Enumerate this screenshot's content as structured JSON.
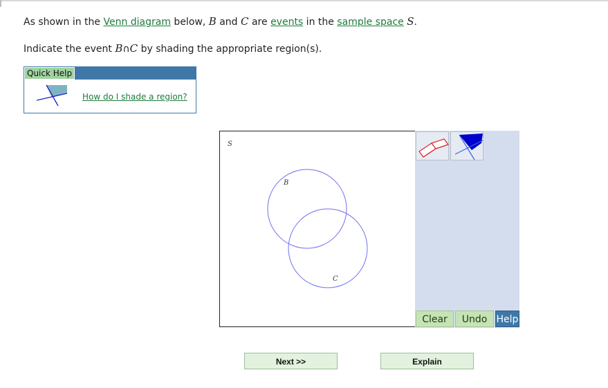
{
  "question": {
    "line1": {
      "pre": "As shown in the ",
      "link1": "Venn diagram",
      "mid1": " below, ",
      "var_b": "B",
      "and": " and ",
      "var_c": "C",
      "are": " are ",
      "link2": "events",
      "mid2": " in the ",
      "link3": "sample space",
      "space": " ",
      "var_s": "S",
      "end": "."
    },
    "line2": {
      "pre": "Indicate the event ",
      "expr_b": "B",
      "op": "∩",
      "expr_c": "C",
      "post": " by shading the appropriate region(s)."
    }
  },
  "quick_help": {
    "tab_label": "Quick Help",
    "link_label": "How do I shade a region?"
  },
  "venn": {
    "space_label": "S",
    "circles": [
      {
        "name": "B",
        "label": "B"
      },
      {
        "name": "C",
        "label": "C"
      }
    ],
    "circle_color": "#6f6ff0"
  },
  "tools": {
    "eraser_icon": "eraser-icon",
    "shade_icon": "shade-region-icon",
    "clear_label": "Clear",
    "undo_label": "Undo",
    "help_label": "Help"
  },
  "navigation": {
    "next_label": "Next >>",
    "explain_label": "Explain"
  },
  "colors": {
    "link": "#1e7a3a",
    "help_bar": "#3f78a8",
    "tool_panel": "#d3ddee",
    "green_button": "#c6e3b6",
    "nav_button": "#e3f2df"
  }
}
